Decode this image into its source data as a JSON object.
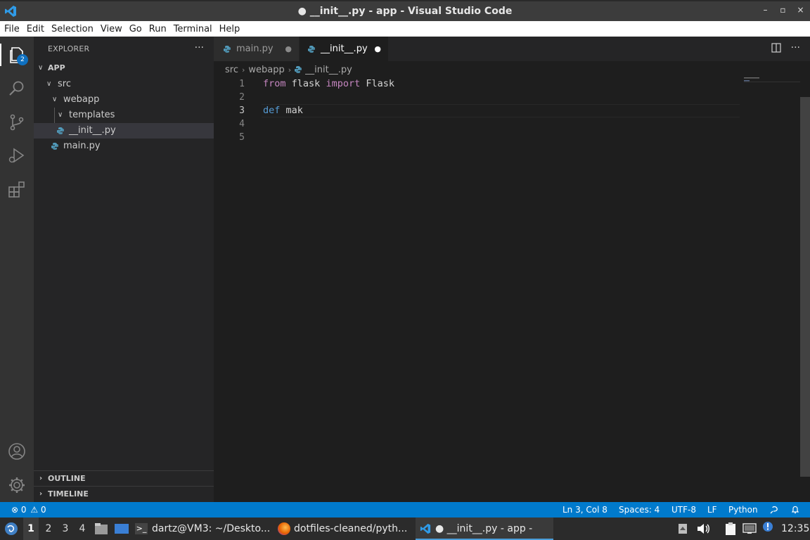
{
  "window": {
    "title": "● __init__.py - app - Visual Studio Code",
    "controls": [
      "–",
      "▫",
      "×"
    ]
  },
  "menu": [
    "File",
    "Edit",
    "Selection",
    "View",
    "Go",
    "Run",
    "Terminal",
    "Help"
  ],
  "activity_bar": {
    "explorer_badge": "2"
  },
  "sidebar": {
    "title": "EXPLORER",
    "more": "···",
    "tree": [
      {
        "label": "APP",
        "kind": "root"
      },
      {
        "label": "src",
        "kind": "folder"
      },
      {
        "label": "webapp",
        "kind": "folder"
      },
      {
        "label": "templates",
        "kind": "folder"
      },
      {
        "label": "__init__.py",
        "kind": "file"
      },
      {
        "label": "main.py",
        "kind": "file"
      }
    ],
    "sections": {
      "outline": "OUTLINE",
      "timeline": "TIMELINE"
    }
  },
  "tabs": [
    {
      "label": "main.py",
      "modified": "●"
    },
    {
      "label": "__init__.py",
      "modified": "●"
    }
  ],
  "breadcrumb": [
    "src",
    "webapp",
    "__init__.py"
  ],
  "editor": {
    "line_numbers": [
      "1",
      "2",
      "3",
      "4",
      "5"
    ],
    "lines": {
      "l1_from": "from",
      "l1_module": "flask",
      "l1_import": "import",
      "l1_name": "Flask",
      "l3_def": "def",
      "l3_name": "mak"
    }
  },
  "statusbar": {
    "errors": "0",
    "warnings": "0",
    "position": "Ln 3, Col 8",
    "spaces": "Spaces: 4",
    "encoding": "UTF-8",
    "eol": "LF",
    "language": "Python"
  },
  "taskbar": {
    "workspaces": [
      "1",
      "2",
      "3",
      "4"
    ],
    "tasks": {
      "terminal": "dartz@VM3: ~/Deskto...",
      "firefox": "dotfiles-cleaned/pyth...",
      "vscode": "● __init__.py - app - Vi..."
    },
    "clock": "12:35"
  },
  "colors": {
    "accent": "#007acc",
    "keyword_import": "#c586c0",
    "keyword_def": "#569cd6"
  }
}
